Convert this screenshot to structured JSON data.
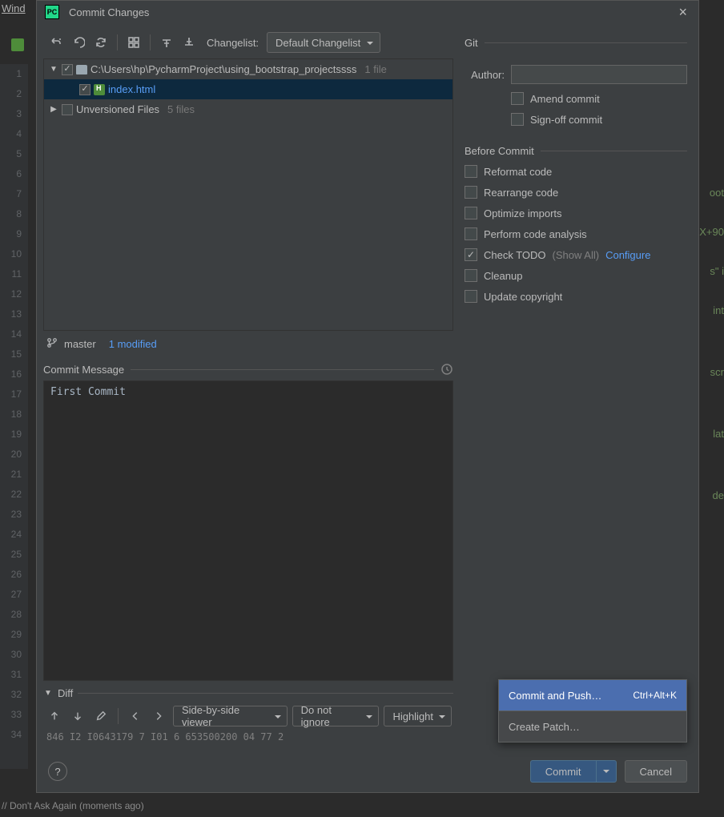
{
  "bg": {
    "menu": "Wind",
    "lines": [
      "1",
      "2",
      "3",
      "4",
      "5",
      "6",
      "7",
      "8",
      "9",
      "10",
      "11",
      "12",
      "13",
      "14",
      "15",
      "16",
      "17",
      "18",
      "19",
      "20",
      "21",
      "22",
      "23",
      "24",
      "25",
      "26",
      "27",
      "28",
      "29",
      "30",
      "31",
      "32",
      "33",
      "34"
    ],
    "code_fragments": [
      "oot",
      "X+90",
      "s\" i",
      "int",
      "scr",
      "lat",
      "de"
    ],
    "status": "// Don't Ask Again (moments ago)"
  },
  "dialog": {
    "title": "Commit Changes",
    "toolbar": {
      "changelist_label": "Changelist:",
      "changelist_value": "Default Changelist"
    },
    "tree": {
      "root_path": "C:\\Users\\hp\\PycharmProject\\using_bootstrap_projectssss",
      "root_meta": "1 file",
      "file": "index.html",
      "unversioned": "Unversioned Files",
      "unversioned_meta": "5 files"
    },
    "branch": {
      "name": "master",
      "modified": "1 modified"
    },
    "commit_message": {
      "title": "Commit Message",
      "value": "First Commit"
    },
    "diff": {
      "title": "Diff",
      "viewer": "Side-by-side viewer",
      "ignore": "Do not ignore",
      "highlight": "Highlight",
      "hash_line": "846 I2 I0643179  7 I01   6  653500200  04  77  2"
    },
    "git": {
      "title": "Git",
      "author_label": "Author:",
      "author_value": "",
      "amend": "Amend commit",
      "signoff": "Sign-off commit"
    },
    "before": {
      "title": "Before Commit",
      "reformat": "Reformat code",
      "rearrange": "Rearrange code",
      "optimize": "Optimize imports",
      "analysis": "Perform code analysis",
      "todo": "Check TODO",
      "todo_extra": "(Show All)",
      "configure": "Configure",
      "cleanup": "Cleanup",
      "copyright": "Update copyright"
    },
    "footer": {
      "commit": "Commit",
      "cancel": "Cancel"
    },
    "menu": {
      "push": "Commit and Push…",
      "push_shortcut": "Ctrl+Alt+K",
      "patch": "Create Patch…"
    }
  }
}
